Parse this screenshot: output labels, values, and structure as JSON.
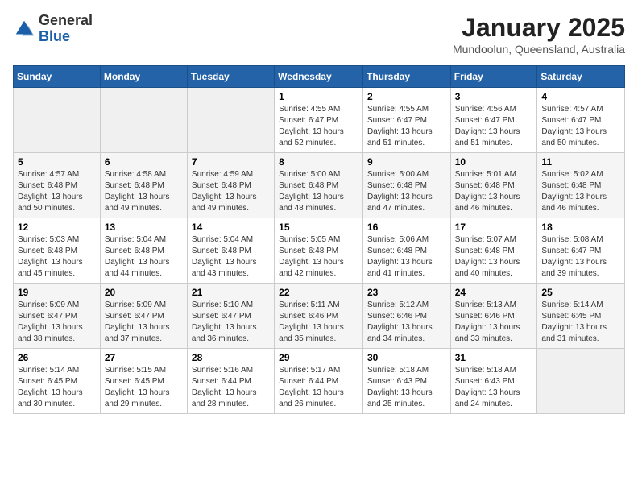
{
  "header": {
    "logo_general": "General",
    "logo_blue": "Blue",
    "calendar_title": "January 2025",
    "calendar_subtitle": "Mundoolun, Queensland, Australia"
  },
  "days_of_week": [
    "Sunday",
    "Monday",
    "Tuesday",
    "Wednesday",
    "Thursday",
    "Friday",
    "Saturday"
  ],
  "weeks": [
    [
      {
        "day": "",
        "info": ""
      },
      {
        "day": "",
        "info": ""
      },
      {
        "day": "",
        "info": ""
      },
      {
        "day": "1",
        "info": "Sunrise: 4:55 AM\nSunset: 6:47 PM\nDaylight: 13 hours\nand 52 minutes."
      },
      {
        "day": "2",
        "info": "Sunrise: 4:55 AM\nSunset: 6:47 PM\nDaylight: 13 hours\nand 51 minutes."
      },
      {
        "day": "3",
        "info": "Sunrise: 4:56 AM\nSunset: 6:47 PM\nDaylight: 13 hours\nand 51 minutes."
      },
      {
        "day": "4",
        "info": "Sunrise: 4:57 AM\nSunset: 6:47 PM\nDaylight: 13 hours\nand 50 minutes."
      }
    ],
    [
      {
        "day": "5",
        "info": "Sunrise: 4:57 AM\nSunset: 6:48 PM\nDaylight: 13 hours\nand 50 minutes."
      },
      {
        "day": "6",
        "info": "Sunrise: 4:58 AM\nSunset: 6:48 PM\nDaylight: 13 hours\nand 49 minutes."
      },
      {
        "day": "7",
        "info": "Sunrise: 4:59 AM\nSunset: 6:48 PM\nDaylight: 13 hours\nand 49 minutes."
      },
      {
        "day": "8",
        "info": "Sunrise: 5:00 AM\nSunset: 6:48 PM\nDaylight: 13 hours\nand 48 minutes."
      },
      {
        "day": "9",
        "info": "Sunrise: 5:00 AM\nSunset: 6:48 PM\nDaylight: 13 hours\nand 47 minutes."
      },
      {
        "day": "10",
        "info": "Sunrise: 5:01 AM\nSunset: 6:48 PM\nDaylight: 13 hours\nand 46 minutes."
      },
      {
        "day": "11",
        "info": "Sunrise: 5:02 AM\nSunset: 6:48 PM\nDaylight: 13 hours\nand 46 minutes."
      }
    ],
    [
      {
        "day": "12",
        "info": "Sunrise: 5:03 AM\nSunset: 6:48 PM\nDaylight: 13 hours\nand 45 minutes."
      },
      {
        "day": "13",
        "info": "Sunrise: 5:04 AM\nSunset: 6:48 PM\nDaylight: 13 hours\nand 44 minutes."
      },
      {
        "day": "14",
        "info": "Sunrise: 5:04 AM\nSunset: 6:48 PM\nDaylight: 13 hours\nand 43 minutes."
      },
      {
        "day": "15",
        "info": "Sunrise: 5:05 AM\nSunset: 6:48 PM\nDaylight: 13 hours\nand 42 minutes."
      },
      {
        "day": "16",
        "info": "Sunrise: 5:06 AM\nSunset: 6:48 PM\nDaylight: 13 hours\nand 41 minutes."
      },
      {
        "day": "17",
        "info": "Sunrise: 5:07 AM\nSunset: 6:48 PM\nDaylight: 13 hours\nand 40 minutes."
      },
      {
        "day": "18",
        "info": "Sunrise: 5:08 AM\nSunset: 6:47 PM\nDaylight: 13 hours\nand 39 minutes."
      }
    ],
    [
      {
        "day": "19",
        "info": "Sunrise: 5:09 AM\nSunset: 6:47 PM\nDaylight: 13 hours\nand 38 minutes."
      },
      {
        "day": "20",
        "info": "Sunrise: 5:09 AM\nSunset: 6:47 PM\nDaylight: 13 hours\nand 37 minutes."
      },
      {
        "day": "21",
        "info": "Sunrise: 5:10 AM\nSunset: 6:47 PM\nDaylight: 13 hours\nand 36 minutes."
      },
      {
        "day": "22",
        "info": "Sunrise: 5:11 AM\nSunset: 6:46 PM\nDaylight: 13 hours\nand 35 minutes."
      },
      {
        "day": "23",
        "info": "Sunrise: 5:12 AM\nSunset: 6:46 PM\nDaylight: 13 hours\nand 34 minutes."
      },
      {
        "day": "24",
        "info": "Sunrise: 5:13 AM\nSunset: 6:46 PM\nDaylight: 13 hours\nand 33 minutes."
      },
      {
        "day": "25",
        "info": "Sunrise: 5:14 AM\nSunset: 6:45 PM\nDaylight: 13 hours\nand 31 minutes."
      }
    ],
    [
      {
        "day": "26",
        "info": "Sunrise: 5:14 AM\nSunset: 6:45 PM\nDaylight: 13 hours\nand 30 minutes."
      },
      {
        "day": "27",
        "info": "Sunrise: 5:15 AM\nSunset: 6:45 PM\nDaylight: 13 hours\nand 29 minutes."
      },
      {
        "day": "28",
        "info": "Sunrise: 5:16 AM\nSunset: 6:44 PM\nDaylight: 13 hours\nand 28 minutes."
      },
      {
        "day": "29",
        "info": "Sunrise: 5:17 AM\nSunset: 6:44 PM\nDaylight: 13 hours\nand 26 minutes."
      },
      {
        "day": "30",
        "info": "Sunrise: 5:18 AM\nSunset: 6:43 PM\nDaylight: 13 hours\nand 25 minutes."
      },
      {
        "day": "31",
        "info": "Sunrise: 5:18 AM\nSunset: 6:43 PM\nDaylight: 13 hours\nand 24 minutes."
      },
      {
        "day": "",
        "info": ""
      }
    ]
  ]
}
